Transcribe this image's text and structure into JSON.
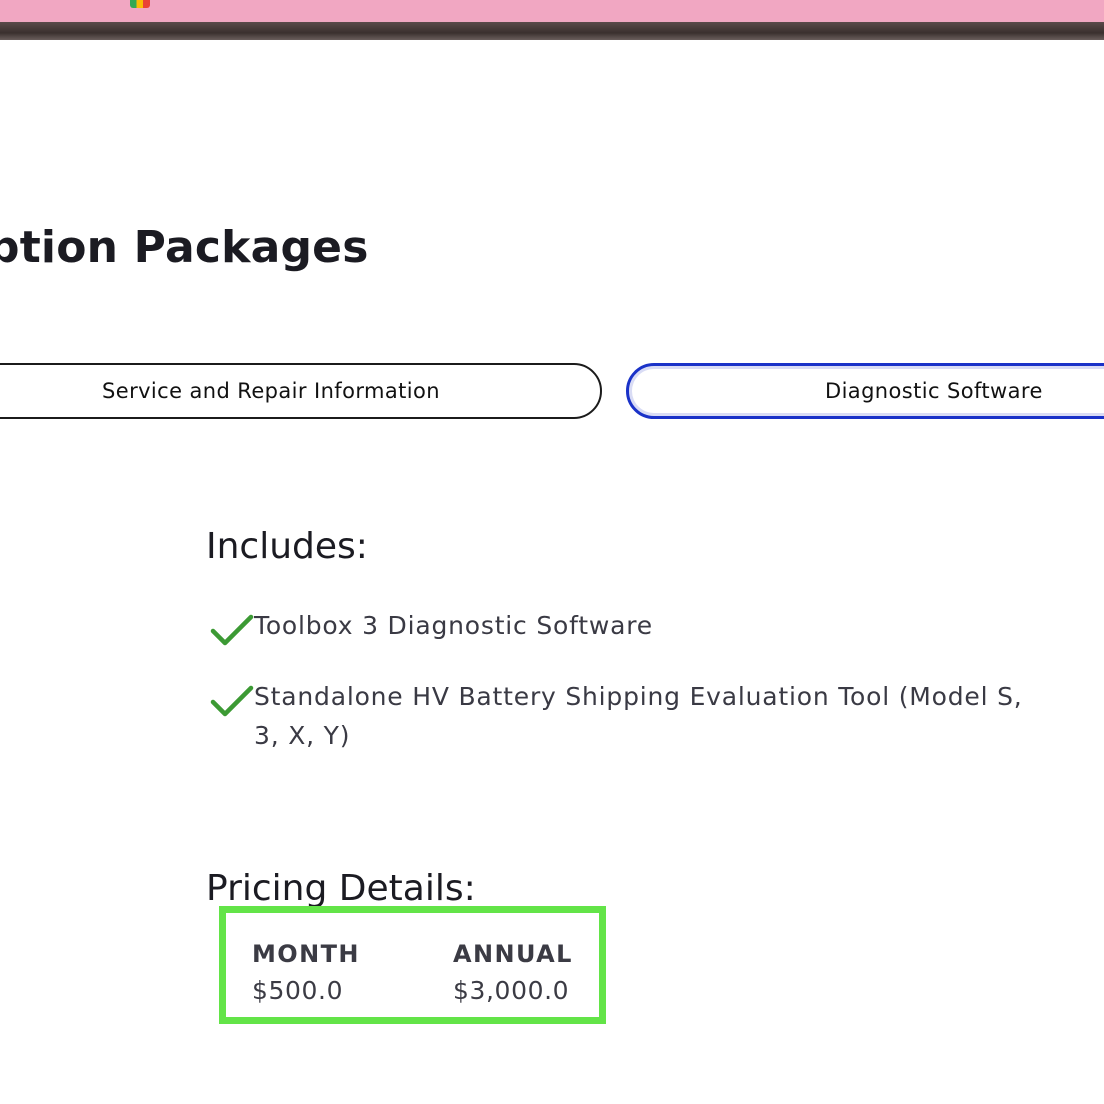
{
  "colors": {
    "active_tab_border": "#1a32c8",
    "check_green": "#3c9a34",
    "highlight_box": "#63e448",
    "chrome_bar": "#f1a7c2"
  },
  "page": {
    "title": "ption Packages"
  },
  "tabs": [
    {
      "label": "Service and Repair Information",
      "active": false
    },
    {
      "label": "Diagnostic Software",
      "active": true
    }
  ],
  "includes": {
    "heading": "Includes:",
    "icon": "check-icon",
    "items": [
      "Toolbox 3 Diagnostic Software",
      "Standalone HV Battery Shipping Evaluation Tool (Model S, 3, X, Y)"
    ]
  },
  "pricing": {
    "heading": "Pricing Details:",
    "plans": [
      {
        "label": "MONTH",
        "price": "$500.0"
      },
      {
        "label": "ANNUAL",
        "price": "$3,000.0"
      }
    ]
  }
}
